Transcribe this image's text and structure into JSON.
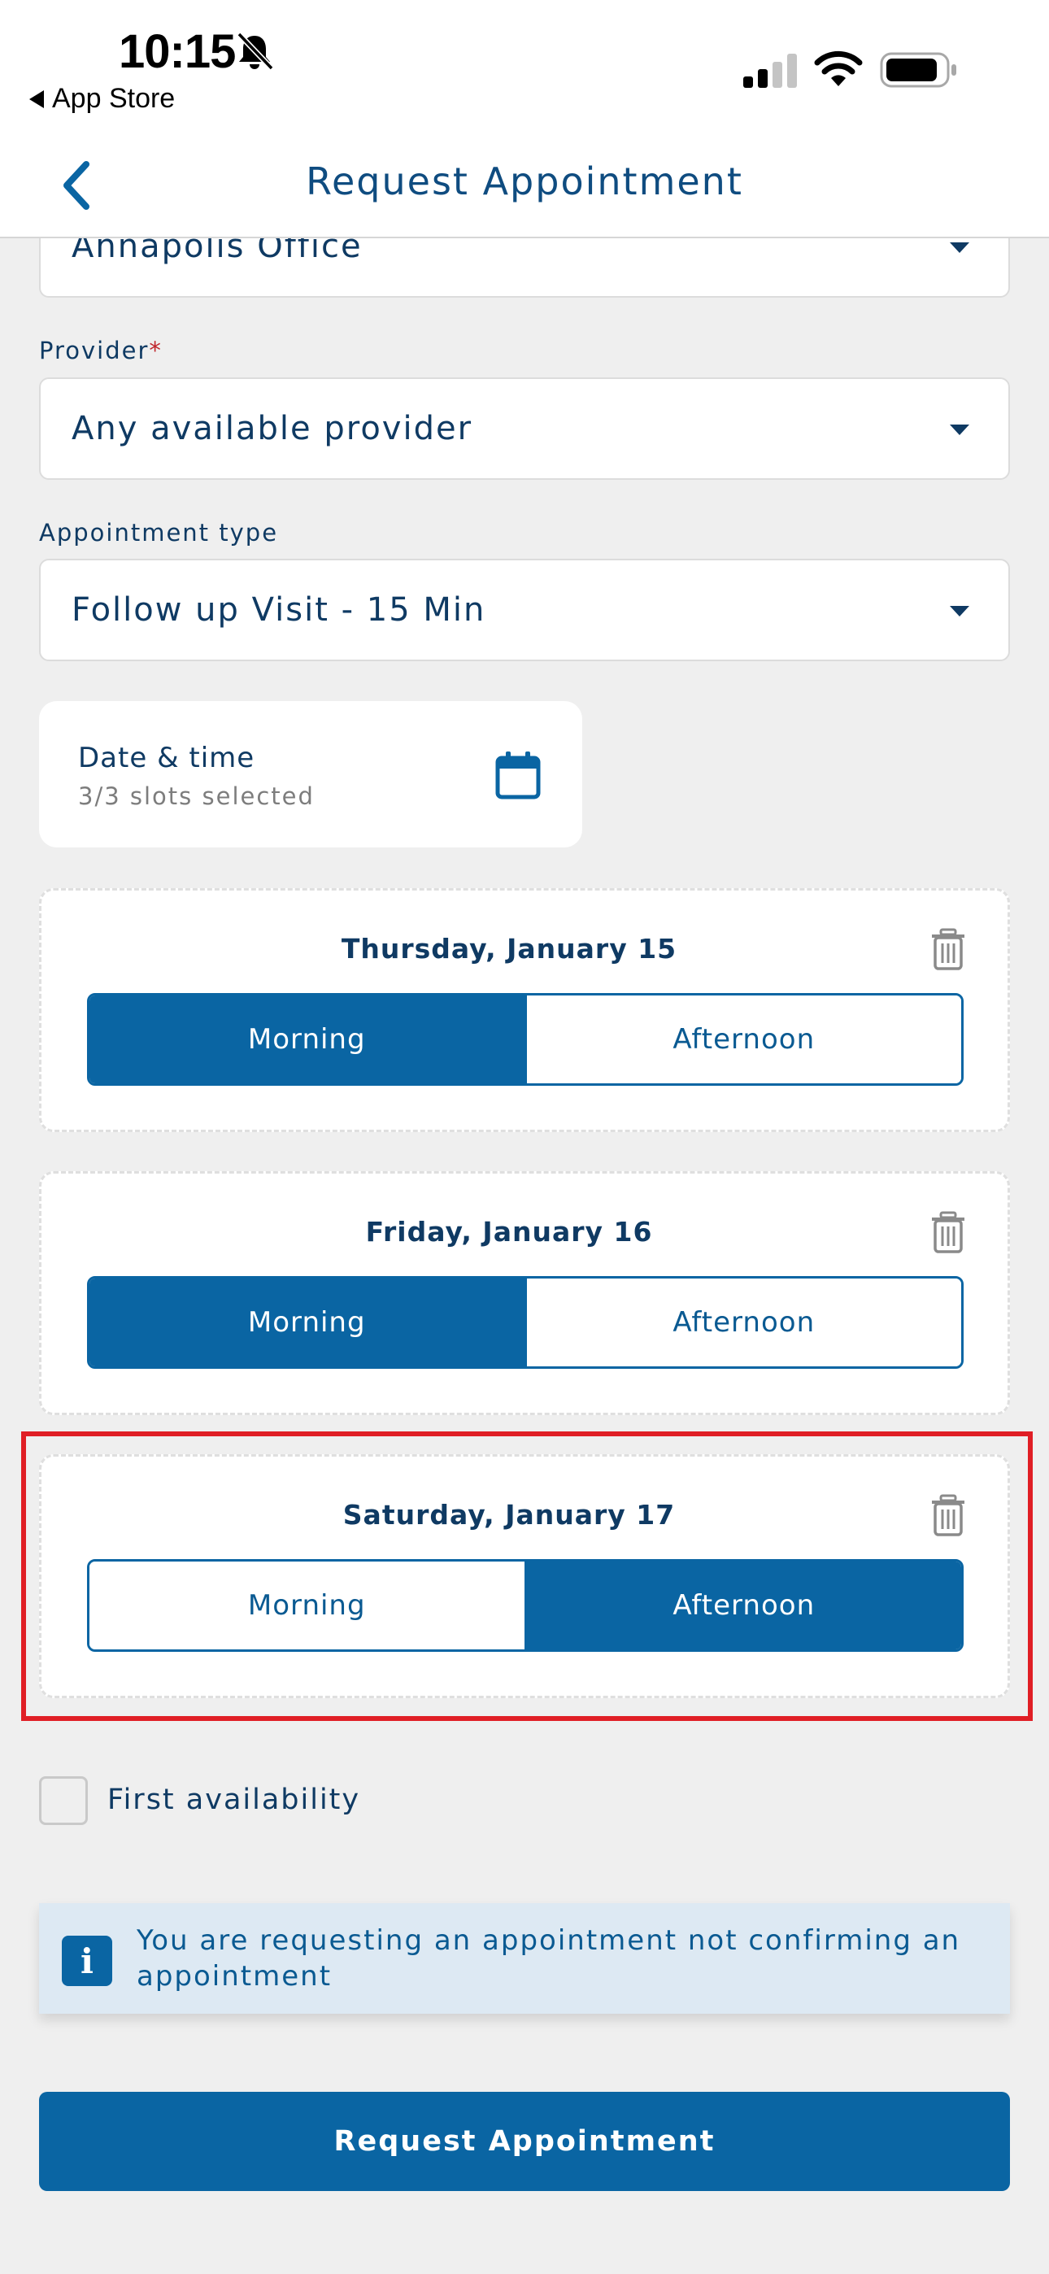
{
  "status_bar": {
    "time": "10:15",
    "back_app": "App Store"
  },
  "nav": {
    "title": "Request Appointment"
  },
  "form": {
    "office_value": "Annapolis Office",
    "provider_label": "Provider",
    "provider_required_mark": "*",
    "provider_value": "Any available provider",
    "appointment_type_label": "Appointment type",
    "appointment_type_value": "Follow up Visit - 15 Min"
  },
  "date_time": {
    "title": "Date & time",
    "subtitle": "3/3 slots selected"
  },
  "slots": [
    {
      "date": "Thursday, January 15",
      "morning": "Morning",
      "afternoon": "Afternoon",
      "selected": "Morning"
    },
    {
      "date": "Friday, January 16",
      "morning": "Morning",
      "afternoon": "Afternoon",
      "selected": "Morning"
    },
    {
      "date": "Saturday, January 17",
      "morning": "Morning",
      "afternoon": "Afternoon",
      "selected": "Afternoon"
    }
  ],
  "first_availability": {
    "label": "First availability",
    "checked": false
  },
  "info": {
    "icon": "info-icon",
    "text": "You are requesting an appointment not confirming an appointment"
  },
  "submit": {
    "label": "Request Appointment"
  },
  "colors": {
    "primary": "#0a65a3",
    "text": "#0f3a63",
    "highlight": "#e01e25",
    "background": "#efefef"
  }
}
